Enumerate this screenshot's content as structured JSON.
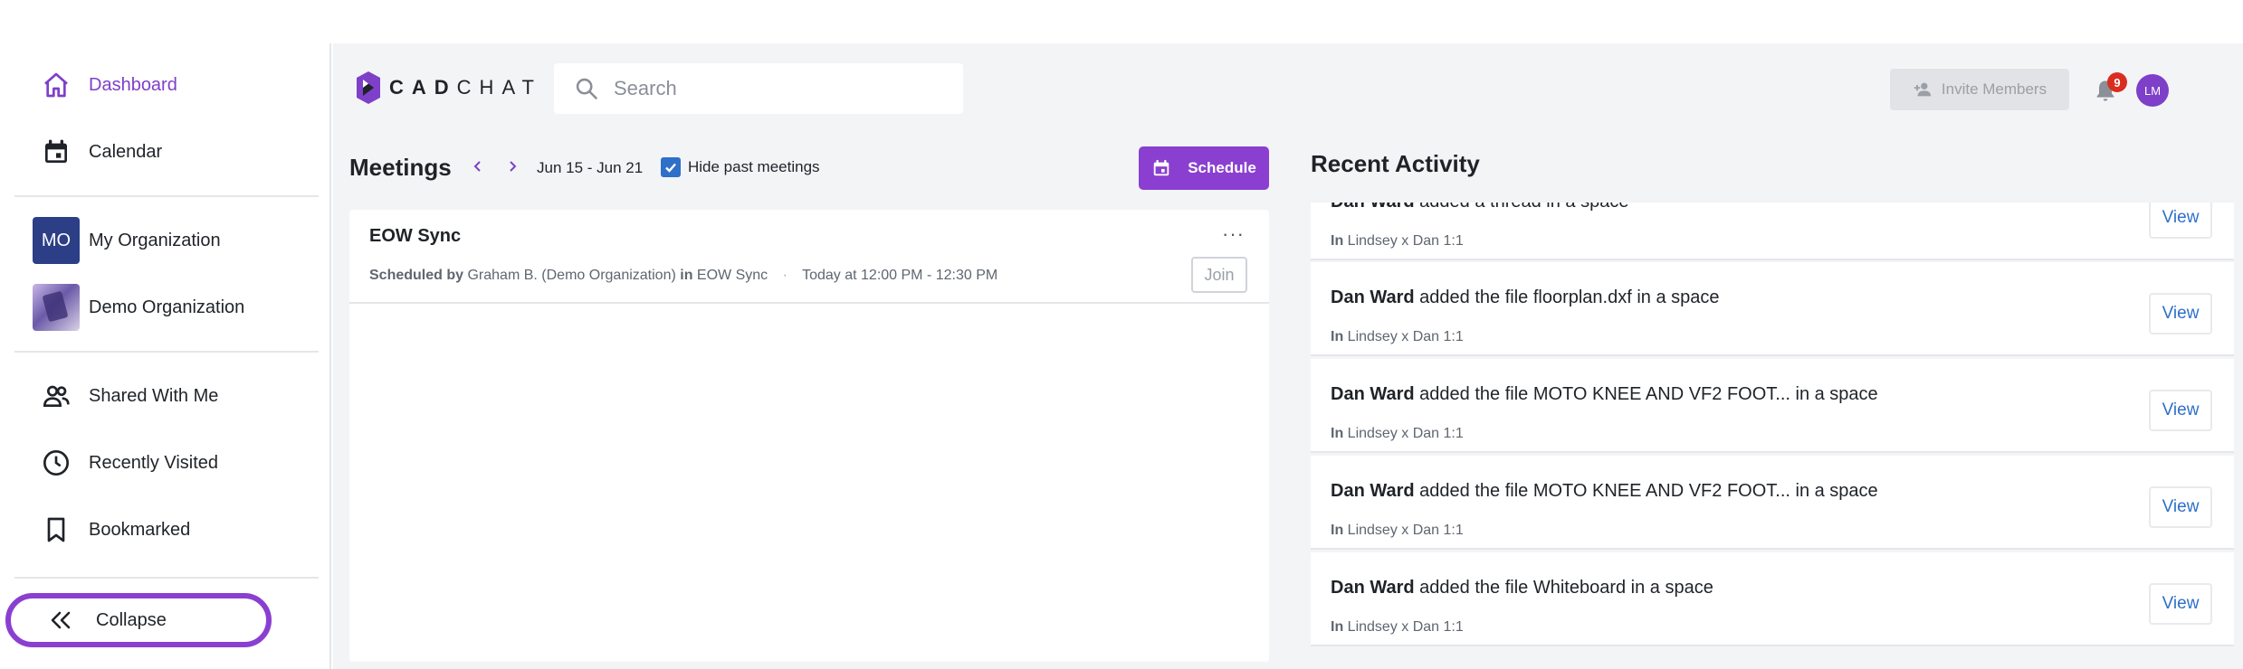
{
  "sidebar": {
    "nav_top": [
      {
        "label": "Dashboard",
        "icon": "home-icon",
        "active": true
      },
      {
        "label": "Calendar",
        "icon": "calendar-icon",
        "active": false
      }
    ],
    "orgs": [
      {
        "label": "My Organization",
        "avatar_text": "MO"
      },
      {
        "label": "Demo Organization",
        "avatar_text": ""
      }
    ],
    "nav_bottom": [
      {
        "label": "Shared With Me",
        "icon": "people-icon"
      },
      {
        "label": "Recently Visited",
        "icon": "clock-icon"
      },
      {
        "label": "Bookmarked",
        "icon": "bookmark-icon"
      }
    ],
    "collapse_label": "Collapse"
  },
  "header": {
    "logo_bold": "CAD",
    "logo_light": "CHAT",
    "search_placeholder": "Search",
    "invite_label": "Invite Members",
    "notification_count": "9",
    "user_initials": "LM"
  },
  "meetings": {
    "title": "Meetings",
    "date_range": "Jun 15 - Jun 21",
    "hide_past_label": "Hide past meetings",
    "hide_past_checked": true,
    "schedule_label": "Schedule",
    "items": [
      {
        "name": "EOW Sync",
        "more": "···",
        "scheduled_by_prefix": "Scheduled by",
        "scheduled_by": "Graham B. (Demo Organization)",
        "in_prefix": "in",
        "space": "EOW Sync",
        "separator": "·",
        "time": "Today at 12:00 PM - 12:30 PM",
        "join_label": "Join"
      }
    ]
  },
  "activity": {
    "title": "Recent Activity",
    "items": [
      {
        "actor": "Dan Ward",
        "text": "added a thread in a space",
        "in_prefix": "In",
        "space": "Lindsey x Dan 1:1",
        "view_label": "View"
      },
      {
        "actor": "Dan Ward",
        "text": "added the file floorplan.dxf in a space",
        "in_prefix": "In",
        "space": "Lindsey x Dan 1:1",
        "view_label": "View"
      },
      {
        "actor": "Dan Ward",
        "text": "added the file MOTO KNEE AND VF2 FOOT... in a space",
        "in_prefix": "In",
        "space": "Lindsey x Dan 1:1",
        "view_label": "View"
      },
      {
        "actor": "Dan Ward",
        "text": "added the file MOTO KNEE AND VF2 FOOT... in a space",
        "in_prefix": "In",
        "space": "Lindsey x Dan 1:1",
        "view_label": "View"
      },
      {
        "actor": "Dan Ward",
        "text": "added the file Whiteboard in a space",
        "in_prefix": "In",
        "space": "Lindsey x Dan 1:1",
        "view_label": "View"
      }
    ]
  },
  "colors": {
    "accent": "#8a3fd1",
    "link": "#2e6fc9",
    "badge": "#d92d20",
    "org_avatar": "#2c3e86"
  }
}
